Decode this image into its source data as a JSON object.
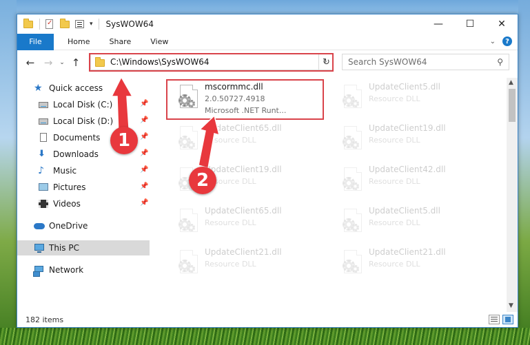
{
  "window": {
    "title": "SysWOW64",
    "controls": {
      "minimize": "—",
      "maximize": "☐",
      "close": "✕"
    }
  },
  "ribbon": {
    "tabs": [
      "File",
      "Home",
      "Share",
      "View"
    ],
    "expand_icon": "chevron-down-icon",
    "help": "?"
  },
  "navigation": {
    "back": "←",
    "forward": "→",
    "recent": "⌄",
    "up": "↑",
    "address": "C:\\Windows\\SysWOW64",
    "search_placeholder": "Search SysWOW64"
  },
  "sidebar": {
    "quick_access": "Quick access",
    "items": [
      {
        "label": "Local Disk (C:)",
        "icon": "drive-icon",
        "pinned": true
      },
      {
        "label": "Local Disk (D:)",
        "icon": "drive-icon",
        "pinned": true
      },
      {
        "label": "Documents",
        "icon": "documents-icon",
        "pinned": true
      },
      {
        "label": "Downloads",
        "icon": "downloads-icon",
        "pinned": true
      },
      {
        "label": "Music",
        "icon": "music-icon",
        "pinned": true
      },
      {
        "label": "Pictures",
        "icon": "pictures-icon",
        "pinned": true
      },
      {
        "label": "Videos",
        "icon": "videos-icon",
        "pinned": true
      }
    ],
    "onedrive": "OneDrive",
    "this_pc": "This PC",
    "network": "Network"
  },
  "files": [
    {
      "name": "mscormmc.dll",
      "version": "2.0.50727.4918",
      "description": "Microsoft .NET Runt...",
      "highlighted": true
    },
    {
      "name": "UpdateClient5.dll",
      "type": "Resource DLL"
    },
    {
      "name": "UpdateClient65.dll",
      "type": "Resource DLL"
    },
    {
      "name": "UpdateClient19.dll",
      "type": "Resource DLL"
    },
    {
      "name": "UpdateClient19.dll",
      "type": "Resource DLL"
    },
    {
      "name": "UpdateClient42.dll",
      "type": "Resource DLL"
    },
    {
      "name": "UpdateClient65.dll",
      "type": "Resource DLL"
    },
    {
      "name": "UpdateClient5.dll",
      "type": "Resource DLL"
    },
    {
      "name": "UpdateClient21.dll",
      "type": "Resource DLL"
    },
    {
      "name": "UpdateClient21.dll",
      "type": "Resource DLL"
    }
  ],
  "status": {
    "item_count": "182 items"
  },
  "annotations": {
    "step1": "1",
    "step2": "2",
    "color": "#e8383d"
  }
}
